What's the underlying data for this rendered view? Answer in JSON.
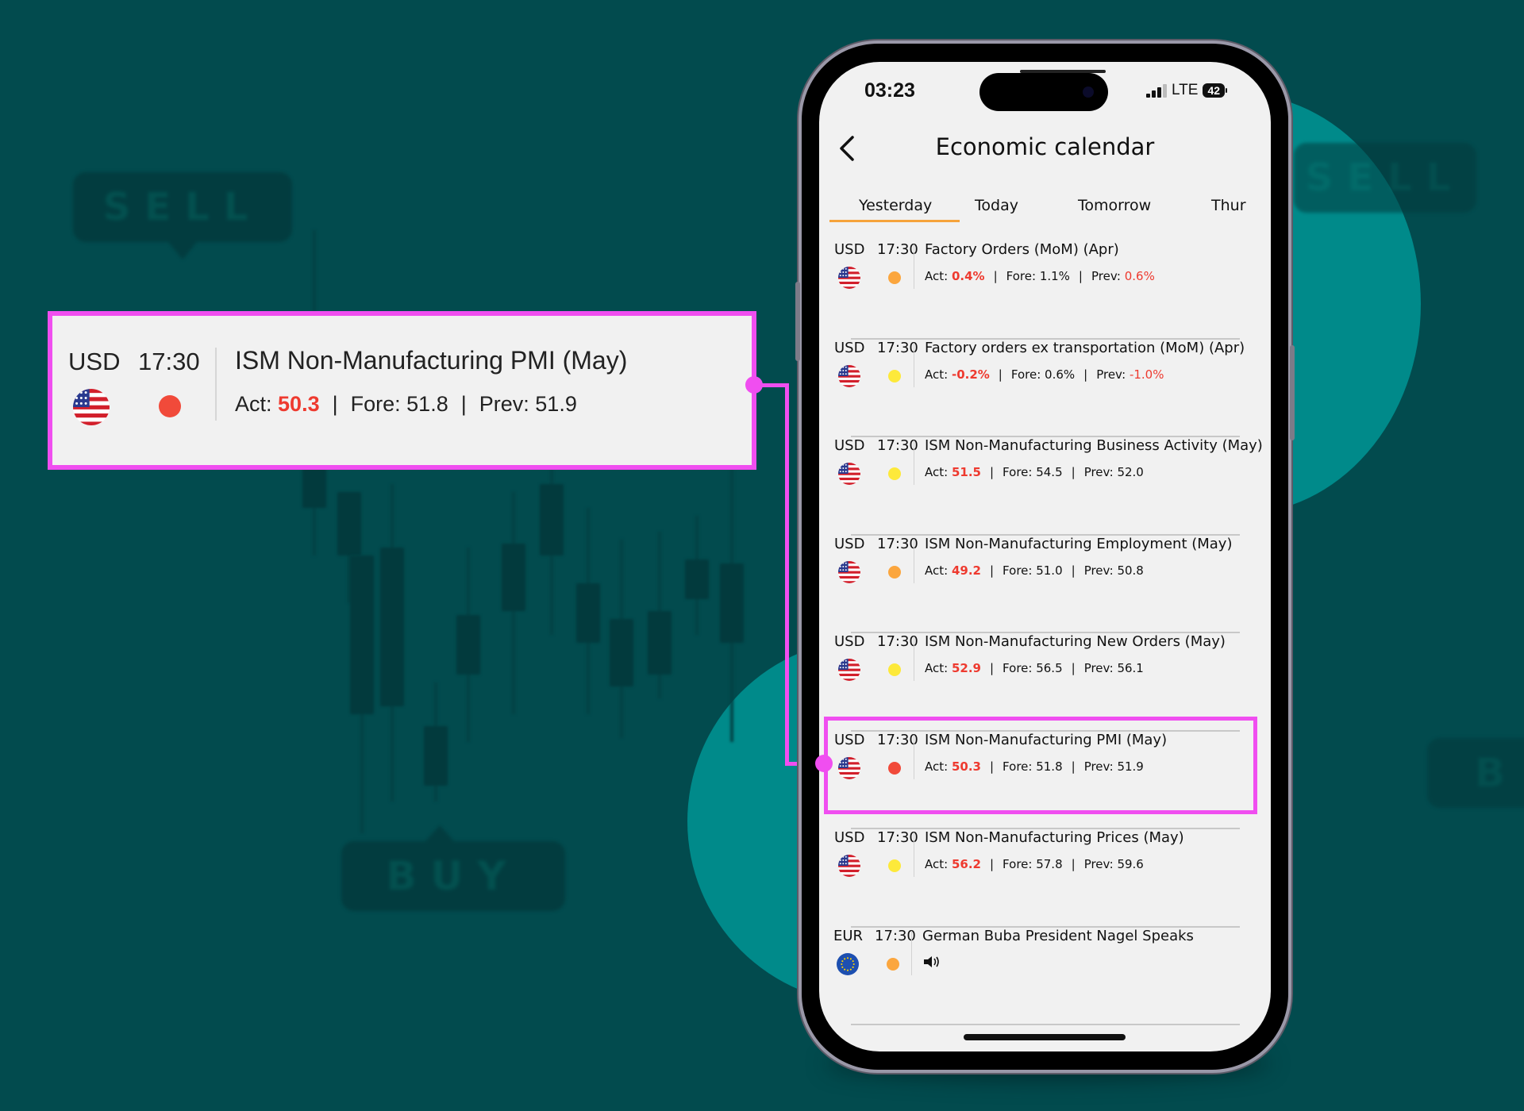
{
  "background": {
    "sell_label": "SELL",
    "buy_label": "BUY",
    "partial_buy_label": "B",
    "colors": {
      "base": "#024b4e",
      "circle": "#008a8a"
    }
  },
  "status_bar": {
    "time": "03:23",
    "network": "LTE",
    "battery": "42",
    "signal_icon": "signal-bars-icon"
  },
  "header": {
    "title": "Economic calendar",
    "back_icon": "chevron-left-icon"
  },
  "tabs": [
    {
      "label": "Yesterday",
      "active": true
    },
    {
      "label": "Today",
      "active": false
    },
    {
      "label": "Tomorrow",
      "active": false
    },
    {
      "label": "Thur",
      "active": false
    }
  ],
  "colors": {
    "accent_tab": "#f6a33b",
    "highlight": "#f04ef0",
    "actual_value": "#ee3a2f",
    "importance_high": "#f14a3a",
    "importance_medium": "#fba63e",
    "importance_low": "#fde93a"
  },
  "events": [
    {
      "currency": "USD",
      "time": "17:30",
      "flag": "us-flag-icon",
      "importance": "medium",
      "title": "Factory Orders (MoM) (Apr)",
      "act_label": "Act:",
      "act": "0.4%",
      "fore_label": "Fore:",
      "fore": "1.1%",
      "prev_label": "Prev:",
      "prev": "0.6%",
      "prev_red": true
    },
    {
      "currency": "USD",
      "time": "17:30",
      "flag": "us-flag-icon",
      "importance": "low",
      "title": "Factory orders ex transportation (MoM) (Apr)",
      "act_label": "Act:",
      "act": "-0.2%",
      "fore_label": "Fore:",
      "fore": "0.6%",
      "prev_label": "Prev:",
      "prev": "-1.0%",
      "prev_red": true
    },
    {
      "currency": "USD",
      "time": "17:30",
      "flag": "us-flag-icon",
      "importance": "low",
      "title": "ISM Non-Manufacturing Business Activity (May)",
      "act_label": "Act:",
      "act": "51.5",
      "fore_label": "Fore:",
      "fore": "54.5",
      "prev_label": "Prev:",
      "prev": "52.0",
      "prev_red": false
    },
    {
      "currency": "USD",
      "time": "17:30",
      "flag": "us-flag-icon",
      "importance": "medium",
      "title": "ISM Non-Manufacturing Employment (May)",
      "act_label": "Act:",
      "act": "49.2",
      "fore_label": "Fore:",
      "fore": "51.0",
      "prev_label": "Prev:",
      "prev": "50.8",
      "prev_red": false
    },
    {
      "currency": "USD",
      "time": "17:30",
      "flag": "us-flag-icon",
      "importance": "low",
      "title": "ISM Non-Manufacturing New Orders (May)",
      "act_label": "Act:",
      "act": "52.9",
      "fore_label": "Fore:",
      "fore": "56.5",
      "prev_label": "Prev:",
      "prev": "56.1",
      "prev_red": false
    },
    {
      "currency": "USD",
      "time": "17:30",
      "flag": "us-flag-icon",
      "importance": "high",
      "title": "ISM Non-Manufacturing PMI (May)",
      "act_label": "Act:",
      "act": "50.3",
      "fore_label": "Fore:",
      "fore": "51.8",
      "prev_label": "Prev:",
      "prev": "51.9",
      "prev_red": false,
      "highlighted": true
    },
    {
      "currency": "USD",
      "time": "17:30",
      "flag": "us-flag-icon",
      "importance": "low",
      "title": "ISM Non-Manufacturing Prices (May)",
      "act_label": "Act:",
      "act": "56.2",
      "fore_label": "Fore:",
      "fore": "57.8",
      "prev_label": "Prev:",
      "prev": "59.6",
      "prev_red": false
    },
    {
      "currency": "EUR",
      "time": "17:30",
      "flag": "eu-flag-icon",
      "importance": "medium",
      "title": "German Buba President Nagel Speaks",
      "speech_icon": "speaker-icon"
    }
  ],
  "callout": {
    "currency": "USD",
    "time": "17:30",
    "flag": "us-flag-icon",
    "importance": "high",
    "title": "ISM Non-Manufacturing PMI (May)",
    "act_label": "Act:",
    "act": "50.3",
    "fore_label": "Fore:",
    "fore": "51.8",
    "prev_label": "Prev:",
    "prev": "51.9"
  }
}
